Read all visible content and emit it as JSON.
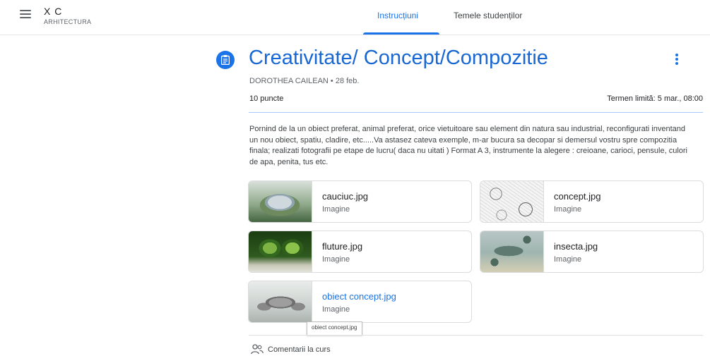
{
  "topbar": {
    "class_name": "X C",
    "class_section": "ARHITECTURA",
    "tabs": [
      {
        "label": "Instrucțiuni",
        "active": true
      },
      {
        "label": "Temele studenților",
        "active": false
      }
    ]
  },
  "assignment": {
    "title": "Creativitate/ Concept/Compozitie",
    "meta": "DOROTHEA CAILEAN • 28 feb.",
    "points": "10 puncte",
    "due": "Termen limită: 5 mar., 08:00",
    "description": "Pornind de la un obiect preferat, animal preferat, orice vietuitoare sau element din natura sau industrial, reconfigurati inventand un nou obiect, spatiu, cladire, etc.....Va astasez cateva exemple, m-ar bucura sa decopar si demersul vostru spre compozitia finala; realizati fotografii pe etape de lucru( daca nu uitati ) Format A 3, instrumente la alegere : creioane, carioci, pensule, culori de apa, penita, tus etc."
  },
  "attachments": [
    {
      "name": "cauciuc.jpg",
      "type": "Imagine"
    },
    {
      "name": "concept.jpg",
      "type": "Imagine"
    },
    {
      "name": "fluture.jpg",
      "type": "Imagine"
    },
    {
      "name": "insecta.jpg",
      "type": "Imagine"
    },
    {
      "name": "obiect concept.jpg",
      "type": "Imagine"
    }
  ],
  "tooltip": "obiect concept.jpg",
  "class_comments": "Comentarii la curs",
  "colors": {
    "accent": "#1a73e8",
    "title": "#1967d2",
    "divider": "#a8c7fa"
  },
  "icons": {
    "menu": "hamburger-menu-icon",
    "assignment": "assignment-icon",
    "more": "more-vert-icon",
    "comments": "people-icon"
  }
}
